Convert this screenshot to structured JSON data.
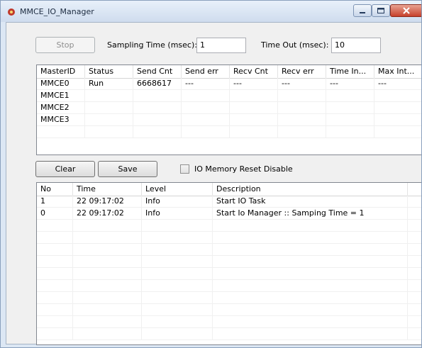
{
  "window": {
    "title": "MMCE_IO_Manager"
  },
  "controls": {
    "stop_label": "Stop",
    "sampling_label": "Sampling Time (msec):",
    "sampling_value": "1",
    "timeout_label": "Time Out (msec):",
    "timeout_value": "10"
  },
  "master_table": {
    "columns": [
      "MasterID",
      "Status",
      "Send Cnt",
      "Send err",
      "Recv Cnt",
      "Recv err",
      "Time In...",
      "Max Int..."
    ],
    "rows": [
      [
        "MMCE0",
        "Run",
        "6668617",
        "---",
        "---",
        "---",
        "---",
        "---"
      ],
      [
        "MMCE1",
        "",
        "",
        "",
        "",
        "",
        "",
        ""
      ],
      [
        "MMCE2",
        "",
        "",
        "",
        "",
        "",
        "",
        ""
      ],
      [
        "MMCE3",
        "",
        "",
        "",
        "",
        "",
        "",
        ""
      ],
      [
        "",
        "",
        "",
        "",
        "",
        "",
        "",
        ""
      ]
    ]
  },
  "actions": {
    "clear_label": "Clear",
    "save_label": "Save",
    "checkbox_label": "IO Memory Reset Disable",
    "checkbox_checked": false
  },
  "log_table": {
    "columns": [
      "No",
      "Time",
      "Level",
      "Description"
    ],
    "rows": [
      [
        "1",
        "22 09:17:02",
        "Info",
        "Start IO Task"
      ],
      [
        "0",
        "22 09:17:02",
        "Info",
        "Start Io Manager :: Samping Time = 1"
      ],
      [
        "",
        "",
        "",
        ""
      ],
      [
        "",
        "",
        "",
        ""
      ],
      [
        "",
        "",
        "",
        ""
      ],
      [
        "",
        "",
        "",
        ""
      ],
      [
        "",
        "",
        "",
        ""
      ],
      [
        "",
        "",
        "",
        ""
      ],
      [
        "",
        "",
        "",
        ""
      ],
      [
        "",
        "",
        "",
        ""
      ],
      [
        "",
        "",
        "",
        ""
      ],
      [
        "",
        "",
        "",
        ""
      ]
    ]
  }
}
